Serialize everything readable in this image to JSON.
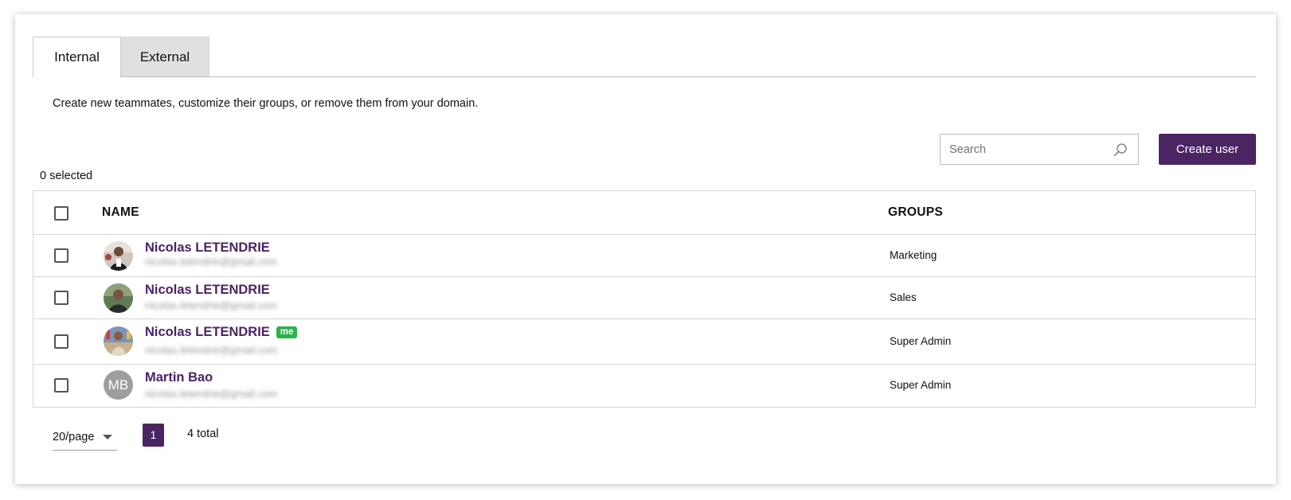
{
  "tabs": [
    {
      "label": "Internal",
      "active": true
    },
    {
      "label": "External",
      "active": false
    }
  ],
  "description": "Create new teammates, customize their groups, or remove them from your domain.",
  "search": {
    "placeholder": "Search",
    "icon": "search-icon"
  },
  "create_button": {
    "label": "Create user"
  },
  "selection": {
    "count_label": "0 selected"
  },
  "table": {
    "headers": {
      "name": "NAME",
      "groups": "GROUPS"
    },
    "rows": [
      {
        "name": "Nicolas LETENDRIE",
        "email": "nicolas.letendrie@gmail.com",
        "group": "Marketing",
        "me": false,
        "avatar": "photo"
      },
      {
        "name": "Nicolas LETENDRIE",
        "email": "nicolas.letendrie@gmail.com",
        "group": "Sales",
        "me": false,
        "avatar": "photo"
      },
      {
        "name": "Nicolas LETENDRIE",
        "email": "nicolas.letendrie@gmail.com",
        "group": "Super Admin",
        "me": true,
        "me_label": "me",
        "avatar": "photo"
      },
      {
        "name": "Martin Bao",
        "email": "nicolas.letendrie@gmail.com",
        "group": "Super Admin",
        "me": false,
        "avatar": "initials",
        "initials": "MB"
      }
    ]
  },
  "pagination": {
    "page_size": "20/page",
    "current_page": "1",
    "total": "4 total"
  },
  "colors": {
    "brand": "#4a2463",
    "me_badge": "#2bb34a",
    "avatar_initials_bg": "#9e9e9e"
  }
}
